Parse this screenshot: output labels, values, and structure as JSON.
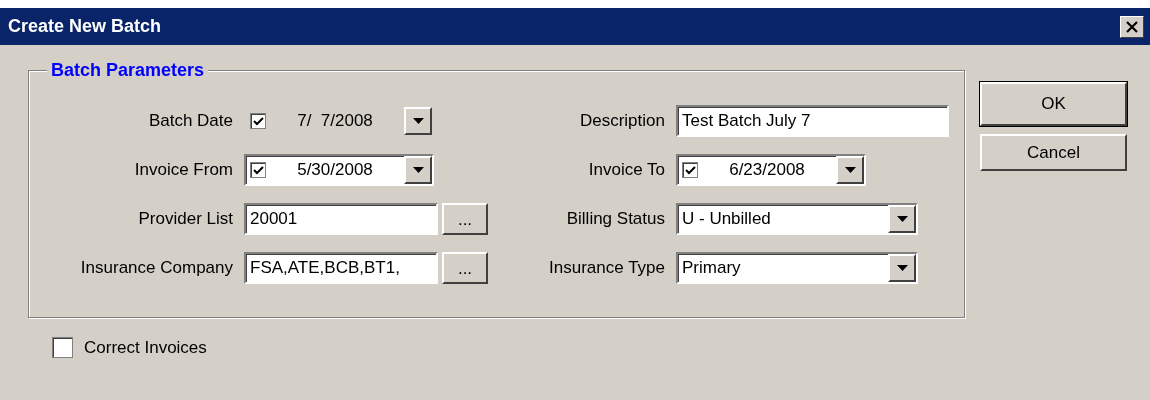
{
  "window": {
    "title": "Create New Batch"
  },
  "group": {
    "title": "Batch Parameters"
  },
  "fields": [
    {
      "label": "Batch Date",
      "kind": "date_flat",
      "checked": true,
      "value": "7/  7/2008"
    },
    {
      "label": "Description",
      "kind": "text",
      "value": "Test Batch July 7"
    },
    {
      "label": "Invoice From",
      "kind": "date",
      "checked": true,
      "value": "5/30/2008"
    },
    {
      "label": "Invoice To",
      "kind": "date",
      "checked": true,
      "value": "6/23/2008"
    },
    {
      "label": "Provider List",
      "kind": "lookup",
      "value": "20001",
      "button": "..."
    },
    {
      "label": "Billing Status",
      "kind": "combo",
      "value": "U - Unbilled"
    },
    {
      "label": "Insurance Company",
      "kind": "lookup",
      "value": "FSA,ATE,BCB,BT1,",
      "button": "..."
    },
    {
      "label": "Insurance Type",
      "kind": "combo",
      "value": "Primary"
    }
  ],
  "buttons": [
    {
      "label": "OK",
      "default": true
    },
    {
      "label": "Cancel",
      "default": false
    }
  ],
  "options": [
    {
      "label": "Correct Invoices",
      "checked": false
    }
  ]
}
